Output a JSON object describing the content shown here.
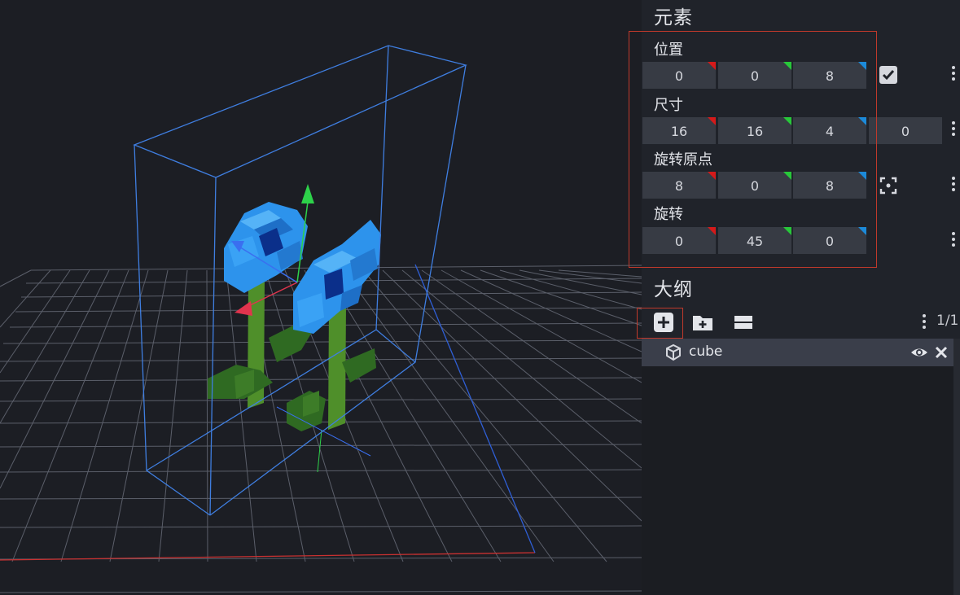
{
  "element_panel": {
    "title": "元素",
    "position": {
      "label": "位置",
      "x": "0",
      "y": "0",
      "z": "8"
    },
    "size": {
      "label": "尺寸",
      "x": "16",
      "y": "16",
      "z": "4",
      "inflate": "0"
    },
    "pivot": {
      "label": "旋转原点",
      "x": "8",
      "y": "0",
      "z": "8"
    },
    "rotation": {
      "label": "旋转",
      "x": "0",
      "y": "45",
      "z": "0"
    }
  },
  "outliner": {
    "title": "大纲",
    "count": "1/1",
    "items": [
      {
        "name": "cube",
        "icon": "cube-icon"
      }
    ]
  },
  "colors": {
    "axis_x": "#d51a1a",
    "axis_y": "#28c83a",
    "axis_z": "#1c8ad9",
    "selection": "#3f7ee0",
    "highlight": "#c0392b"
  }
}
